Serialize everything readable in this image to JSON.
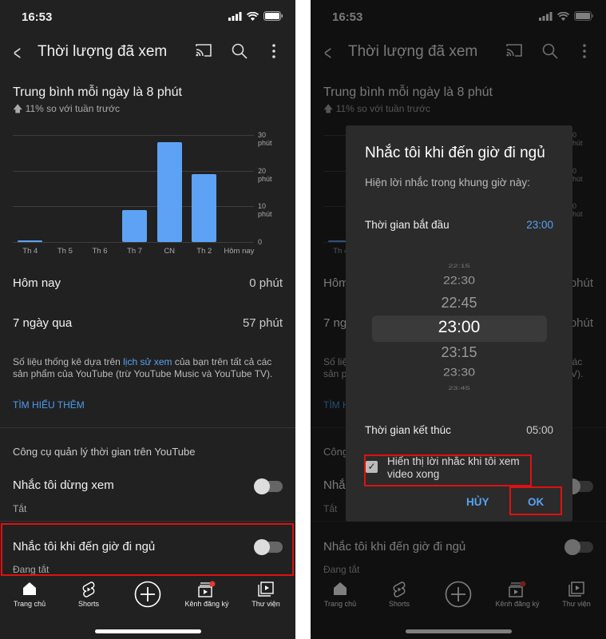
{
  "status": {
    "time": "16:53"
  },
  "header": {
    "title": "Thời lượng đã xem",
    "back_icon": "chevron-left-icon",
    "cast_icon": "cast-icon",
    "search_icon": "search-icon",
    "more_icon": "more-vert-icon"
  },
  "summary": {
    "average": "Trung bình mỗi ngày là 8 phút",
    "change": "11% so với tuần trước"
  },
  "chart_data": {
    "type": "bar",
    "categories": [
      "Th 4",
      "Th 5",
      "Th 6",
      "Th 7",
      "CN",
      "Th 2",
      "Hôm nay"
    ],
    "values": [
      0.5,
      0,
      0,
      9,
      28,
      19,
      0
    ],
    "y_ticks": [
      {
        "value": 0,
        "label": "0"
      },
      {
        "value": 10,
        "label": "10\nphút"
      },
      {
        "value": 20,
        "label": "20\nphút"
      },
      {
        "value": 30,
        "label": "30\nphút"
      }
    ],
    "ylim": [
      0,
      30
    ],
    "grid": true,
    "color": "#5ea2f5"
  },
  "stats": {
    "today_label": "Hôm nay",
    "today_value": "0 phút",
    "week_label": "7 ngày qua",
    "week_value": "57 phút"
  },
  "note": {
    "before": "Số liệu thống kê dựa trên ",
    "link": "lịch sử xem",
    "after": " của bạn trên tất cả các sản phẩm của YouTube (trừ YouTube Music và YouTube TV).",
    "learn_more": "TÌM HIỂU THÊM"
  },
  "tools": {
    "section": "Công cụ quản lý thời gian trên YouTube",
    "items": [
      {
        "title": "Nhắc tôi dừng xem",
        "status": "Tắt",
        "enabled": false
      },
      {
        "title": "Nhắc tôi khi đến giờ đi ngủ",
        "status": "Đang tắt",
        "enabled": false
      }
    ]
  },
  "nav": [
    {
      "label": "Trang chủ",
      "icon": "home-icon"
    },
    {
      "label": "Shorts",
      "icon": "shorts-icon"
    },
    {
      "label": "",
      "icon": "add-icon"
    },
    {
      "label": "Kênh đăng ký",
      "icon": "subscriptions-icon"
    },
    {
      "label": "Thư viện",
      "icon": "library-icon"
    }
  ],
  "dialog": {
    "title": "Nhắc tôi khi đến giờ đi ngủ",
    "subtitle": "Hiện lời nhắc trong khung giờ này:",
    "start_label": "Thời gian bắt đầu",
    "start_value": "23:00",
    "picker": [
      "22:15",
      "22:30",
      "22:45",
      "23:00",
      "23:15",
      "23:30",
      "23:45"
    ],
    "end_label": "Thời gian kết thúc",
    "end_value": "05:00",
    "checkbox_label": "Hiển thị lời nhắc khi tôi xem video xong",
    "checkbox_checked": true,
    "cancel": "HỦY",
    "ok": "OK"
  },
  "colors": {
    "accent": "#5aa2f0",
    "highlight": "#e01010",
    "background": "#212121"
  }
}
